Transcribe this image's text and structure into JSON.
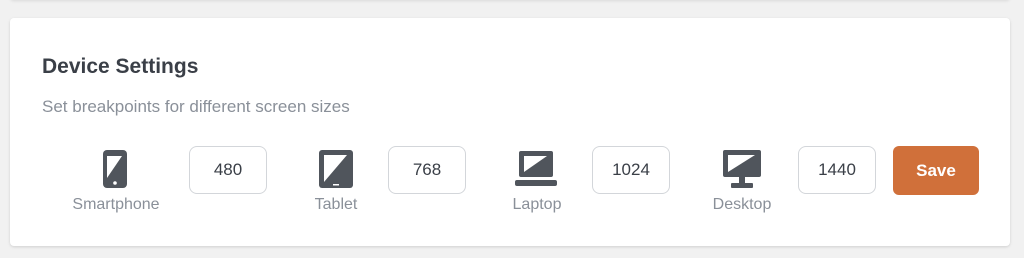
{
  "settings": {
    "title": "Device Settings",
    "subtitle": "Set breakpoints for different screen sizes",
    "save_label": "Save"
  },
  "devices": [
    {
      "label": "Smartphone",
      "value": "480",
      "icon": "smartphone-icon"
    },
    {
      "label": "Tablet",
      "value": "768",
      "icon": "tablet-icon"
    },
    {
      "label": "Laptop",
      "value": "1024",
      "icon": "laptop-icon"
    },
    {
      "label": "Desktop",
      "value": "1440",
      "icon": "desktop-icon"
    }
  ],
  "colors": {
    "accent": "#d0703a",
    "icon": "#50555c",
    "text_primary": "#3a3f47",
    "text_secondary": "#8a9099"
  }
}
